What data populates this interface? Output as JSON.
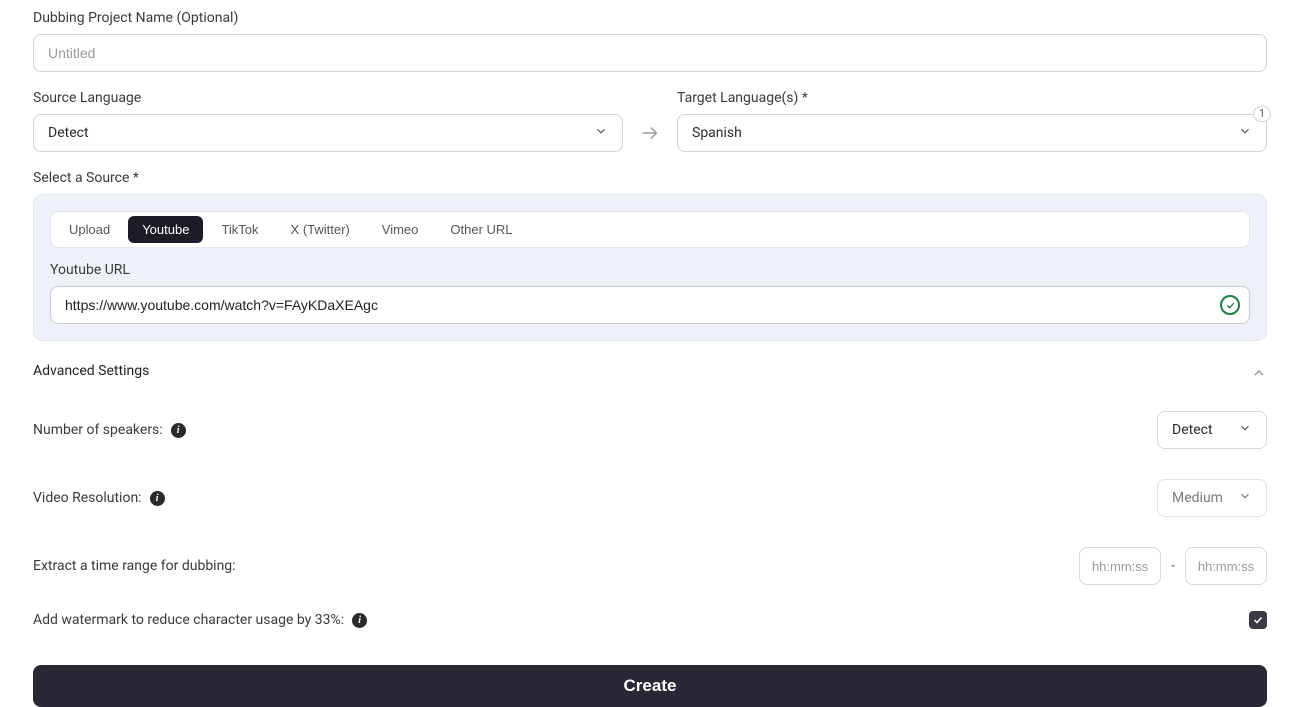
{
  "project_name": {
    "label": "Dubbing Project Name (Optional)",
    "placeholder": "Untitled",
    "value": ""
  },
  "source_lang": {
    "label": "Source Language",
    "value": "Detect"
  },
  "target_lang": {
    "label": "Target Language(s) *",
    "value": "Spanish",
    "count": "1"
  },
  "source_select": {
    "label": "Select a Source *",
    "tabs": [
      "Upload",
      "Youtube",
      "TikTok",
      "X (Twitter)",
      "Vimeo",
      "Other URL"
    ],
    "active_tab_index": 1,
    "url_label": "Youtube URL",
    "url_value": "https://www.youtube.com/watch?v=FAyKDaXEAgc"
  },
  "advanced": {
    "header": "Advanced Settings",
    "speakers_label": "Number of speakers:",
    "speakers_value": "Detect",
    "resolution_label": "Video Resolution:",
    "resolution_value": "Medium",
    "range_label": "Extract a time range for dubbing:",
    "time_placeholder": "hh:mm:ss",
    "watermark_label": "Add watermark to reduce character usage by 33%:",
    "watermark_checked": true
  },
  "create_label": "Create"
}
